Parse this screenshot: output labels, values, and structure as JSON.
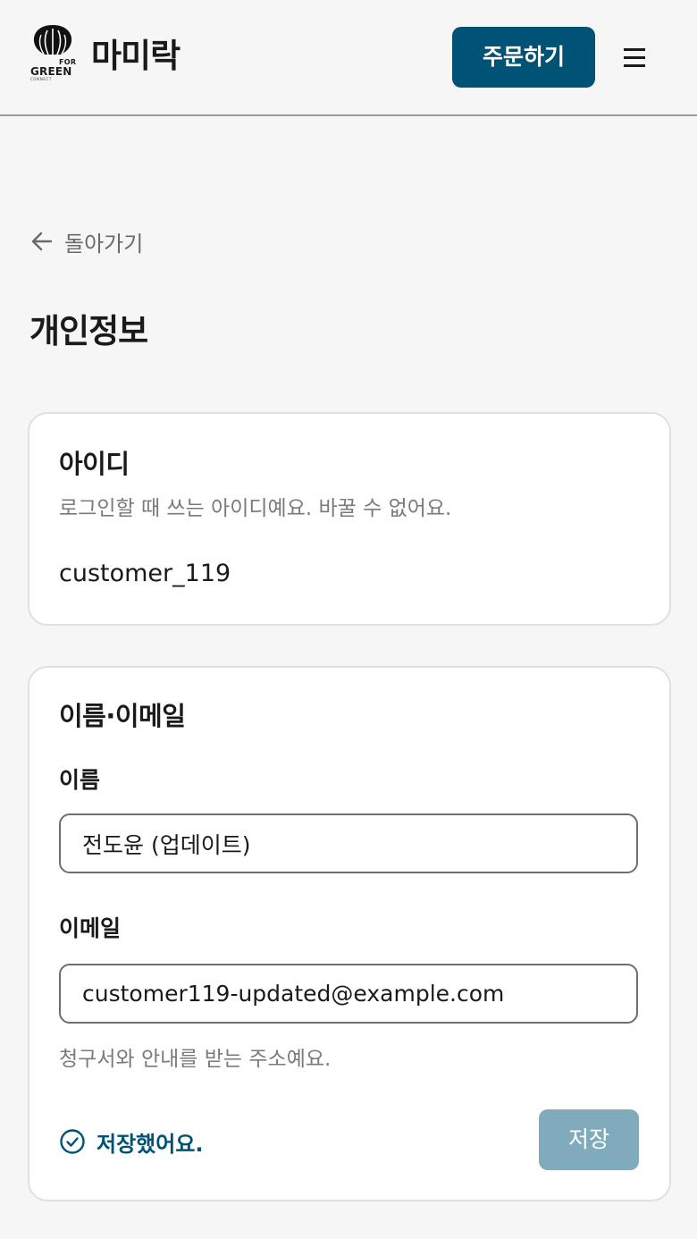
{
  "header": {
    "logo": {
      "icon": "leaf-logo-icon",
      "for_text": "FOR",
      "green_text": "GREEN",
      "connect_text": "CONNECT"
    },
    "brand_name": "마미락",
    "order_button": "주문하기",
    "menu_icon": "hamburger-menu-icon"
  },
  "back_link": {
    "icon": "arrow-left-icon",
    "label": "돌아가기"
  },
  "page_title": "개인정보",
  "id_card": {
    "title": "아이디",
    "description": "로그인할 때 쓰는 아이디예요. 바꿀 수 없어요.",
    "value": "customer_119"
  },
  "profile_card": {
    "title": "이름·이메일",
    "name_label": "이름",
    "name_value": "전도윤 (업데이트)",
    "email_label": "이메일",
    "email_value": "customer119-updated@example.com",
    "email_hint": "청구서와 안내를 받는 주소예요.",
    "saved_icon": "check-circle-icon",
    "saved_message": "저장했어요.",
    "save_button": "저장"
  },
  "colors": {
    "primary": "#005374",
    "primary_disabled": "#80abbc",
    "background": "#f6f6f6",
    "card": "#ffffff"
  }
}
